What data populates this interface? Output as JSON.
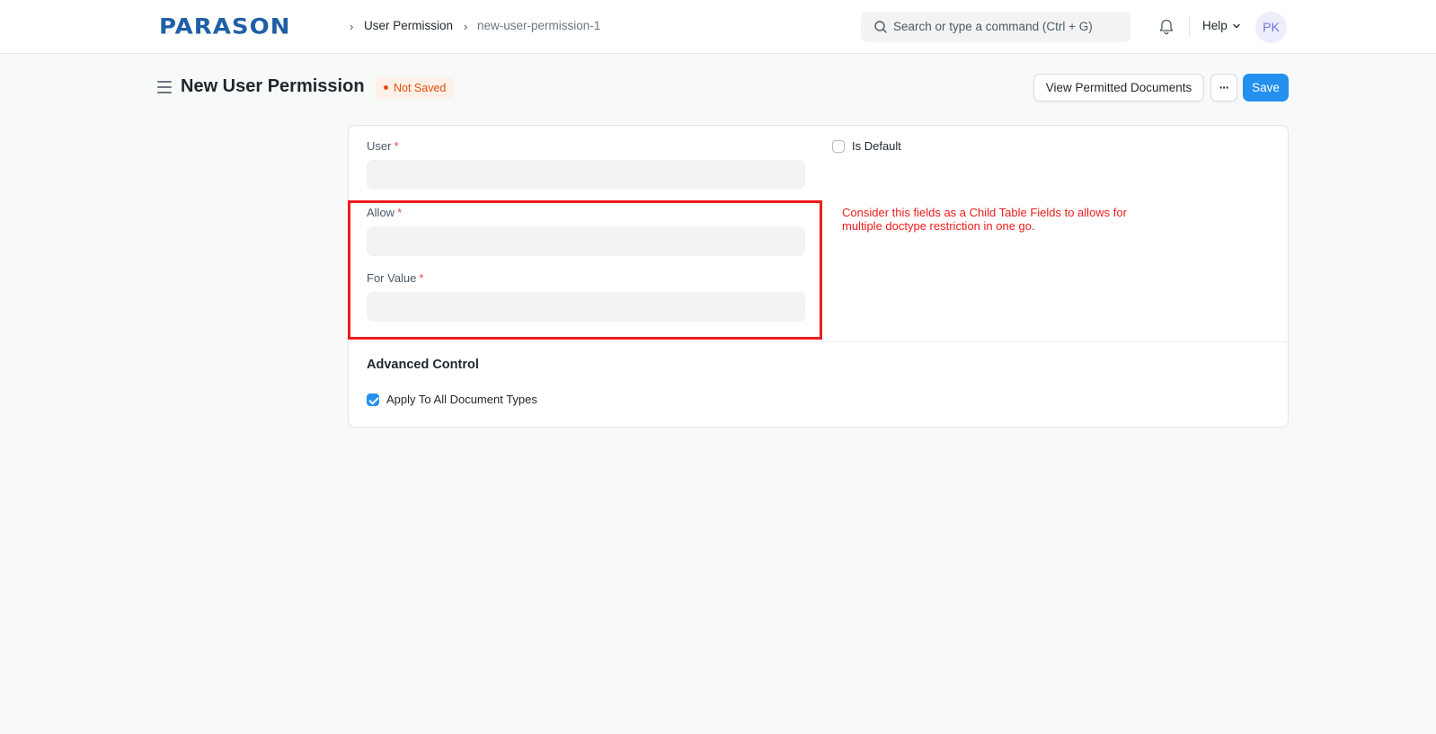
{
  "navbar": {
    "logo_text": "PARASON",
    "breadcrumbs": [
      "User Permission",
      "new-user-permission-1"
    ],
    "search_placeholder": "Search or type a command (Ctrl + G)",
    "help_label": "Help",
    "avatar_initials": "PK"
  },
  "page": {
    "title": "New User Permission",
    "status_badge": "Not Saved",
    "actions": {
      "view_permitted": "View Permitted Documents",
      "more": "···",
      "save": "Save"
    }
  },
  "form": {
    "user": {
      "label": "User",
      "required_mark": "*",
      "value": ""
    },
    "is_default": {
      "label": "Is Default",
      "checked": false
    },
    "allow": {
      "label": "Allow",
      "required_mark": "*",
      "value": ""
    },
    "for_value": {
      "label": "For Value",
      "required_mark": "*",
      "value": ""
    },
    "annotation_note": "Consider this fields as a Child Table Fields to allows for multiple doctype restriction in one go.",
    "advanced_section": {
      "title": "Advanced Control",
      "apply_to_all": {
        "label": "Apply To All Document Types",
        "checked": true
      }
    }
  },
  "colors": {
    "primary": "#2490ef",
    "annotation_red": "#ee1c1c",
    "badge_orange": "#e2500f",
    "logo_blue": "#1f5fa6"
  },
  "icons": [
    "search-icon",
    "bell-icon",
    "chevron-down-icon",
    "hamburger-icon",
    "chevron-right-icon",
    "check-icon"
  ]
}
